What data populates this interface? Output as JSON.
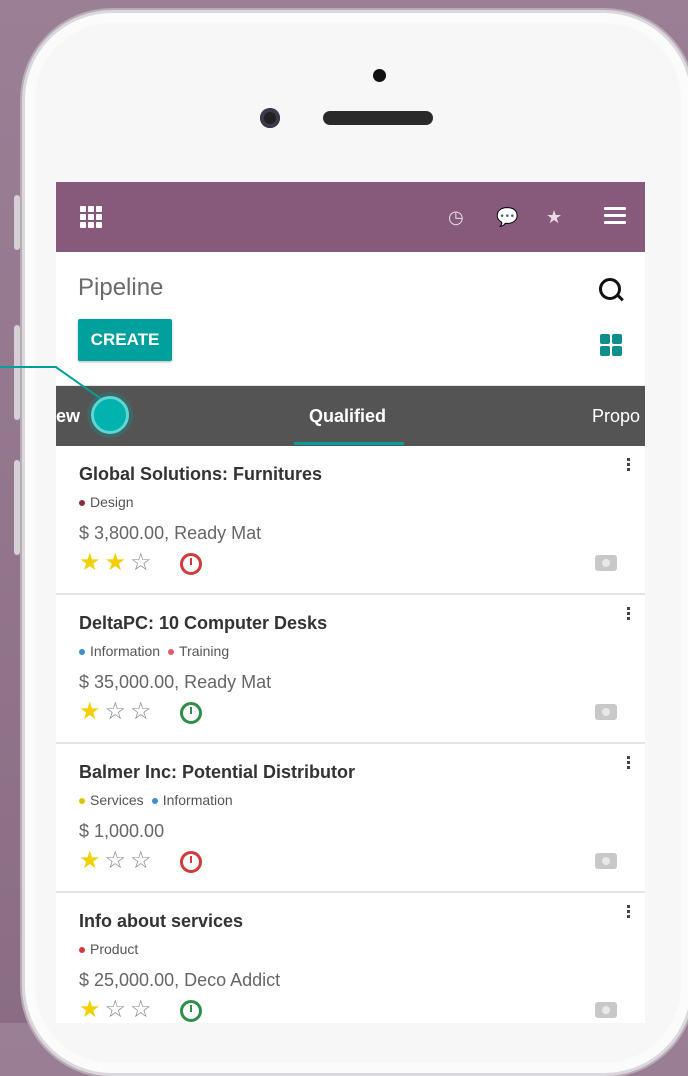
{
  "topbar": {
    "icons": [
      "apps-grid-icon",
      "clock-icon",
      "chat-icon",
      "bug-icon",
      "hamburger-menu-icon"
    ],
    "background": "#875a7b"
  },
  "control": {
    "title": "Pipeline",
    "create_label": "CREATE"
  },
  "stages": {
    "left_partial": "ew",
    "active": "Qualified",
    "right_partial": "Propo"
  },
  "cards": [
    {
      "title": "Global Solutions: Furnitures",
      "tags": [
        {
          "label": "Design",
          "color": "#8b2e42"
        }
      ],
      "amount": "$ 3,800.00, Ready Mat",
      "stars": 2,
      "activity_color": "#d33b3b"
    },
    {
      "title": "DeltaPC: 10 Computer Desks",
      "tags": [
        {
          "label": "Information",
          "color": "#3a8fd0"
        },
        {
          "label": "Training",
          "color": "#e25b6a"
        }
      ],
      "amount": "$ 35,000.00, Ready Mat",
      "stars": 1,
      "activity_color": "#2f8f4a"
    },
    {
      "title": "Balmer Inc: Potential Distributor",
      "tags": [
        {
          "label": "Services",
          "color": "#d8c700"
        },
        {
          "label": "Information",
          "color": "#3a8fd0"
        }
      ],
      "amount": "$ 1,000.00",
      "stars": 1,
      "activity_color": "#d33b3b"
    },
    {
      "title": "Info about services",
      "tags": [
        {
          "label": "Product",
          "color": "#d33b3b"
        }
      ],
      "amount": "$ 25,000.00, Deco Addict",
      "stars": 1,
      "activity_color": "#2f8f4a"
    }
  ],
  "colors": {
    "accent": "#00a09d",
    "primary": "#875a7b"
  }
}
